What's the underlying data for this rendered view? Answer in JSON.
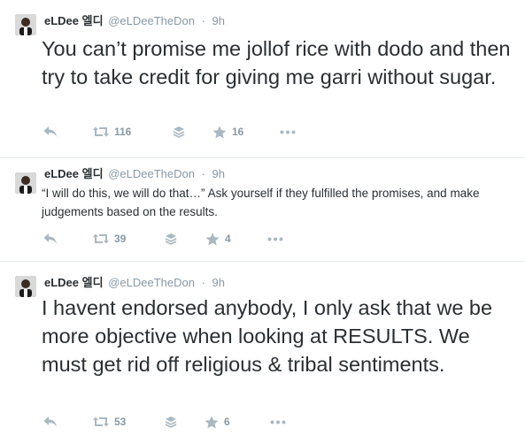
{
  "tweets": [
    {
      "author_name": "eLDee 엘디",
      "handle": "@eLDeeTheDon",
      "separator": "·",
      "time": "9h",
      "text": "You can’t promise me jollof rice with dodo and then try to take credit for giving me garri without sugar.",
      "retweets": "116",
      "likes": "16"
    },
    {
      "author_name": "eLDee 엘디",
      "handle": "@eLDeeTheDon",
      "separator": "·",
      "time": "9h",
      "text": "“I will do this, we will do that…” Ask yourself if they fulfilled the promises, and make judgements based on the results.",
      "retweets": "39",
      "likes": "4"
    },
    {
      "author_name": "eLDee 엘디",
      "handle": "@eLDeeTheDon",
      "separator": "·",
      "time": "9h",
      "text": "I havent endorsed anybody, I only ask that we be more objective when looking at RESULTS. We must get rid off religious & tribal sentiments.",
      "retweets": "53",
      "likes": "6"
    }
  ],
  "icons": {
    "reply": "reply-icon",
    "retweet": "retweet-icon",
    "buffer": "buffer-stack-icon",
    "like": "star-icon",
    "more": "more-dots-icon"
  },
  "colors": {
    "text": "#292f33",
    "meta": "#8899a6",
    "icon": "#aab8c2",
    "divider": "#e1e8ed"
  }
}
